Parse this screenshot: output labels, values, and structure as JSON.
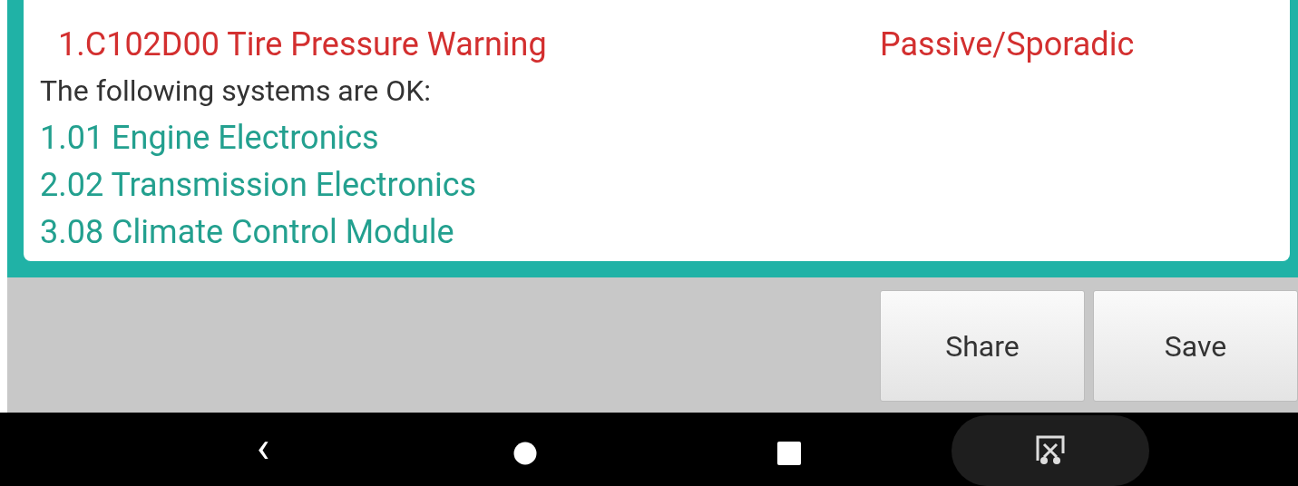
{
  "report": {
    "faults": [
      {
        "code": "1.C102D00 Tire Pressure Warning",
        "status": "Passive/Sporadic"
      }
    ],
    "ok_heading": "The following systems are OK:",
    "ok_systems": [
      "1.01 Engine Electronics",
      "2.02 Transmission Electronics",
      "3.08 Climate Control Module"
    ]
  },
  "buttons": [
    "Share",
    "Save"
  ],
  "nav_bar": {
    "back": "‹"
  }
}
